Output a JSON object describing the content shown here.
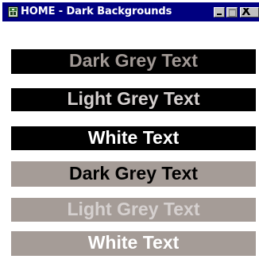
{
  "window": {
    "title": "HOME - Dark Backgrounds",
    "icon": "app-window-icon",
    "controls": {
      "minimize_icon": "minimize-icon",
      "maximize_icon": "maximize-icon",
      "close_glyph": "X"
    }
  },
  "colors": {
    "titlebar": "#000080",
    "black": "#000000",
    "grey_background": "#a59c97",
    "dark_grey_text": "#a19995",
    "light_grey_text": "#d5d0cf",
    "white_text": "#ffffff"
  },
  "samples": [
    {
      "label": "Dark Grey Text",
      "background": "#000000",
      "text_color": "#a19995"
    },
    {
      "label": "Light Grey Text",
      "background": "#000000",
      "text_color": "#d5d0cf"
    },
    {
      "label": "White Text",
      "background": "#000000",
      "text_color": "#ffffff"
    },
    {
      "label": "Dark Grey Text",
      "background": "#a59c97",
      "text_color": "#000000"
    },
    {
      "label": "Light Grey Text",
      "background": "#a59c97",
      "text_color": "#d5d0cf"
    },
    {
      "label": "White Text",
      "background": "#a59c97",
      "text_color": "#ffffff"
    }
  ]
}
